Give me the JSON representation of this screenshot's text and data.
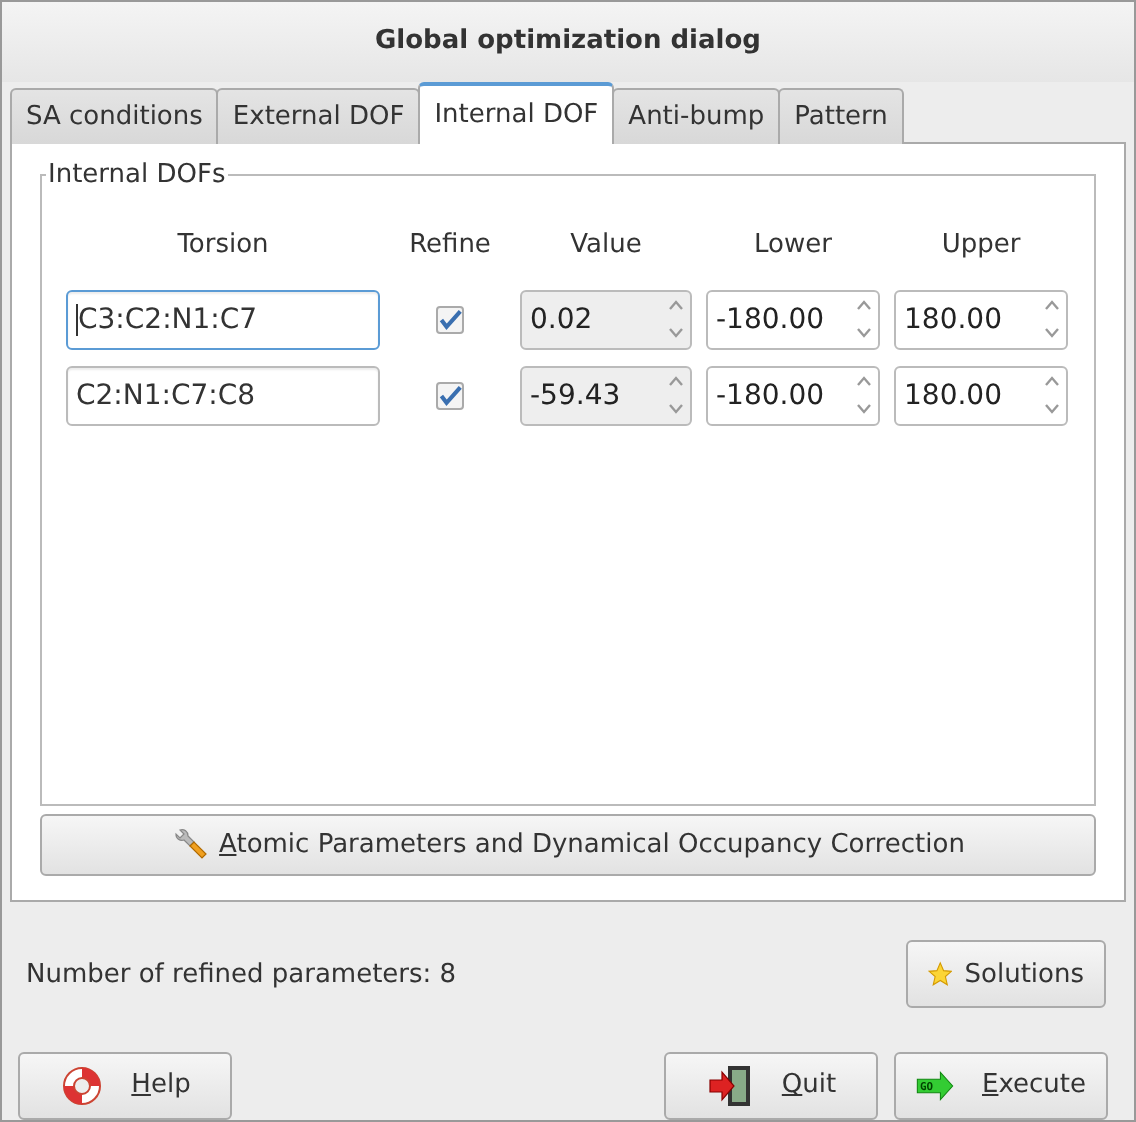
{
  "window": {
    "title": "Global optimization dialog"
  },
  "tabs": [
    {
      "label": "SA conditions",
      "selected": false
    },
    {
      "label": "External DOF",
      "selected": false
    },
    {
      "label": "Internal DOF",
      "selected": true
    },
    {
      "label": "Anti-bump",
      "selected": false
    },
    {
      "label": "Pattern",
      "selected": false
    }
  ],
  "group": {
    "title": "Internal DOFs",
    "columns": [
      "Torsion",
      "Refine",
      "Value",
      "Lower",
      "Upper"
    ],
    "rows": [
      {
        "torsion": "C3:C2:N1:C7",
        "focused": true,
        "refine": true,
        "value": "0.02",
        "lower": "-180.00",
        "upper": "180.00"
      },
      {
        "torsion": "C2:N1:C7:C8",
        "focused": false,
        "refine": true,
        "value": "-59.43",
        "lower": "-180.00",
        "upper": "180.00"
      }
    ]
  },
  "atomic_button": {
    "mnemonic": "A",
    "rest": "tomic Parameters and Dynamical Occupancy Correction"
  },
  "status": "Number of refined parameters: 8",
  "solutions_button": {
    "label": "Solutions"
  },
  "buttons": [
    {
      "kind": "help",
      "mnemonic": "H",
      "rest": "elp"
    },
    {
      "kind": "quit",
      "mnemonic": "Q",
      "rest": "uit"
    },
    {
      "kind": "execute",
      "mnemonic": "E",
      "rest": "xecute",
      "icon_text": "GO"
    }
  ]
}
